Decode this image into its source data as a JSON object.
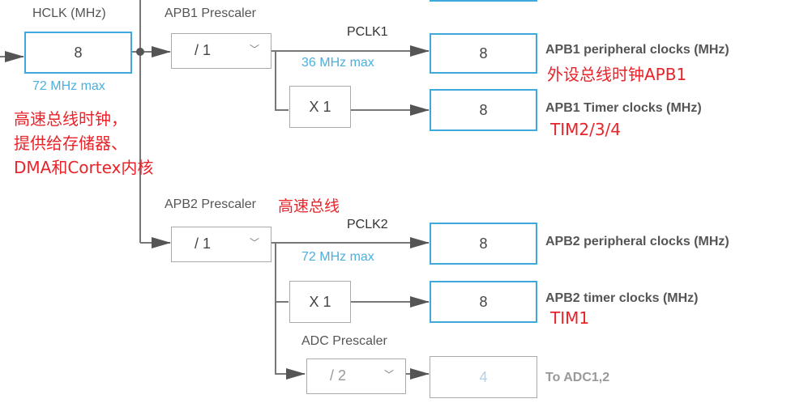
{
  "hclk": {
    "label": "HCLK (MHz)",
    "value": "8",
    "max": "72 MHz max"
  },
  "apb1": {
    "prescaler_label": "APB1 Prescaler",
    "prescaler_value": "/ 1",
    "clock_name": "PCLK1",
    "max": "36 MHz max",
    "multiplier": "X 1",
    "peripheral_value": "8",
    "peripheral_label": "APB1 peripheral clocks (MHz)",
    "timer_value": "8",
    "timer_label": "APB1 Timer clocks (MHz)"
  },
  "apb2": {
    "prescaler_label": "APB2 Prescaler",
    "prescaler_value": "/ 1",
    "clock_name": "PCLK2",
    "max": "72 MHz max",
    "multiplier": "X 1",
    "peripheral_value": "8",
    "peripheral_label": "APB2 peripheral clocks (MHz)",
    "timer_value": "8",
    "timer_label": "APB2 timer clocks (MHz)"
  },
  "adc": {
    "prescaler_label": "ADC Prescaler",
    "prescaler_value": "/ 2",
    "value": "4",
    "label": "To ADC1,2"
  },
  "annotations": {
    "hclk_note": [
      "高速总线时钟，",
      "提供给存储器、",
      "DMA和Cortex内核"
    ],
    "apb1_note": "外设总线时钟APB1",
    "apb1_timer_note": "TIM2/3/4",
    "apb2_note": "高速总线",
    "apb2_timer_note": "TIM1"
  }
}
